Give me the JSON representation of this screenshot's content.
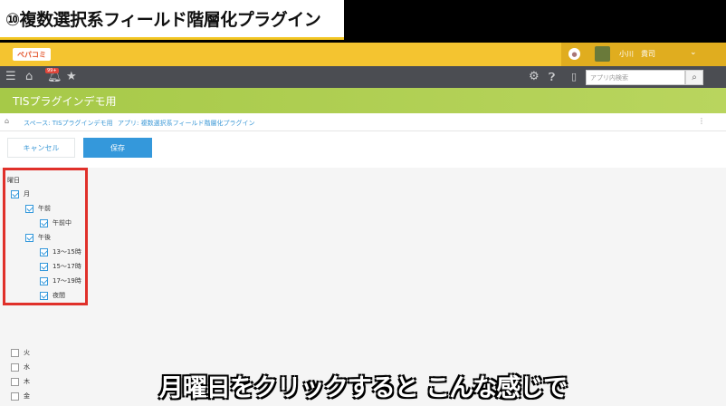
{
  "video": {
    "title": "⑩複数選択系フィールド階層化プラグイン",
    "subtitle": "月曜日をクリックすると こんな感じで"
  },
  "header": {
    "logo_text": "ペパコミ",
    "user_name": "小川　貴司",
    "brand_color": "#f4c430"
  },
  "navbar": {
    "badge_text": "99+",
    "search_placeholder": "アプリ内検索",
    "icons": [
      "menu-icon",
      "home-icon",
      "bell-icon",
      "star-icon",
      "gear-icon",
      "help-icon",
      "mobile-icon",
      "search-icon"
    ]
  },
  "app": {
    "title": "TISプラグインデモ用"
  },
  "breadcrumb": {
    "space": "スペース: TISプラグインデモ用",
    "app": "アプリ: 複数選択系フィールド階層化プラグイン"
  },
  "actions": {
    "cancel_label": "キャンセル",
    "save_label": "保存"
  },
  "form": {
    "field_label": "曜日",
    "items": [
      {
        "label": "月",
        "checked": true
      },
      {
        "label": "午前",
        "checked": true
      },
      {
        "label": "午前中",
        "checked": true
      },
      {
        "label": "午後",
        "checked": true
      },
      {
        "label": "13〜15時",
        "checked": true
      },
      {
        "label": "15〜17時",
        "checked": true
      },
      {
        "label": "17〜19時",
        "checked": true
      },
      {
        "label": "夜間",
        "checked": true
      },
      {
        "label": "火",
        "checked": false
      },
      {
        "label": "水",
        "checked": false
      },
      {
        "label": "木",
        "checked": false
      },
      {
        "label": "金",
        "checked": false
      }
    ]
  }
}
